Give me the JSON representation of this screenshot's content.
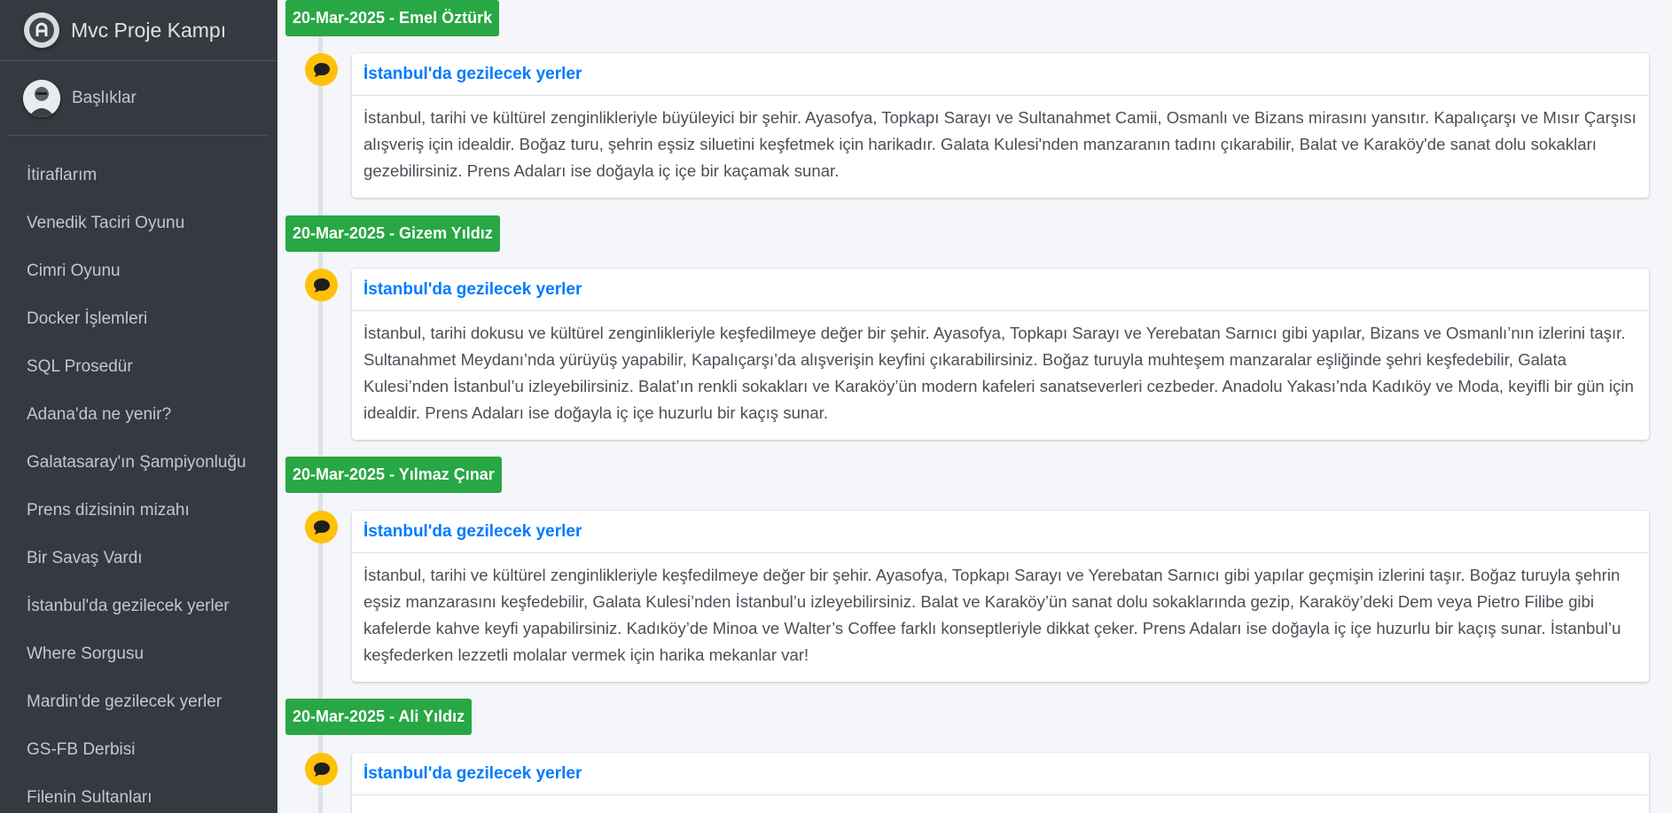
{
  "brand": {
    "title": "Mvc Proje Kampı"
  },
  "user": {
    "name": "Başlıklar"
  },
  "sidebar": {
    "items": [
      {
        "label": "İtiraflarım"
      },
      {
        "label": "Venedik Taciri Oyunu"
      },
      {
        "label": "Cimri Oyunu"
      },
      {
        "label": "Docker İşlemleri"
      },
      {
        "label": "SQL Prosedür"
      },
      {
        "label": "Adana'da ne yenir?"
      },
      {
        "label": "Galatasaray'ın Şampiyonluğu"
      },
      {
        "label": "Prens dizisinin mizahı"
      },
      {
        "label": "Bir Savaş Vardı"
      },
      {
        "label": "İstanbul'da gezilecek yerler"
      },
      {
        "label": "Where Sorgusu"
      },
      {
        "label": "Mardin'de gezilecek yerler"
      },
      {
        "label": "GS-FB Derbisi"
      },
      {
        "label": "Filenin Sultanları"
      }
    ]
  },
  "timeline": {
    "entries": [
      {
        "label": "20-Mar-2025 - Emel Öztürk",
        "title": "İstanbul'da gezilecek yerler",
        "body": "İstanbul, tarihi ve kültürel zenginlikleriyle büyüleyici bir şehir. Ayasofya, Topkapı Sarayı ve Sultanahmet Camii, Osmanlı ve Bizans mirasını yansıtır. Kapalıçarşı ve Mısır Çarşısı alışveriş için idealdir. Boğaz turu, şehrin eşsiz siluetini keşfetmek için harikadır. Galata Kulesi'nden manzaranın tadını çıkarabilir, Balat ve Karaköy'de sanat dolu sokakları gezebilirsiniz. Prens Adaları ise doğayla iç içe bir kaçamak sunar."
      },
      {
        "label": "20-Mar-2025 - Gizem Yıldız",
        "title": "İstanbul'da gezilecek yerler",
        "body": "İstanbul, tarihi dokusu ve kültürel zenginlikleriyle keşfedilmeye değer bir şehir. Ayasofya, Topkapı Sarayı ve Yerebatan Sarnıcı gibi yapılar, Bizans ve Osmanlı’nın izlerini taşır. Sultanahmet Meydanı’nda yürüyüş yapabilir, Kapalıçarşı’da alışverişin keyfini çıkarabilirsiniz. Boğaz turuyla muhteşem manzaralar eşliğinde şehri keşfedebilir, Galata Kulesi’nden İstanbul’u izleyebilirsiniz. Balat’ın renkli sokakları ve Karaköy’ün modern kafeleri sanatseverleri cezbeder. Anadolu Yakası’nda Kadıköy ve Moda, keyifli bir gün için idealdir. Prens Adaları ise doğayla iç içe huzurlu bir kaçış sunar."
      },
      {
        "label": "20-Mar-2025 - Yılmaz Çınar",
        "title": "İstanbul'da gezilecek yerler",
        "body": "İstanbul, tarihi ve kültürel zenginlikleriyle keşfedilmeye değer bir şehir. Ayasofya, Topkapı Sarayı ve Yerebatan Sarnıcı gibi yapılar geçmişin izlerini taşır. Boğaz turuyla şehrin eşsiz manzarasını keşfedebilir, Galata Kulesi’nden İstanbul’u izleyebilirsiniz. Balat ve Karaköy’ün sanat dolu sokaklarında gezip, Karaköy’deki Dem veya Pietro Filibe gibi kafelerde kahve keyfi yapabilirsiniz. Kadıköy’de Minoa ve Walter’s Coffee farklı konseptleriyle dikkat çeker. Prens Adaları ise doğayla iç içe huzurlu bir kaçış sunar. İstanbul’u keşfederken lezzetli molalar vermek için harika mekanlar var!"
      },
      {
        "label": "20-Mar-2025 - Ali Yıldız",
        "title": "İstanbul'da gezilecek yerler",
        "body": ""
      }
    ]
  }
}
